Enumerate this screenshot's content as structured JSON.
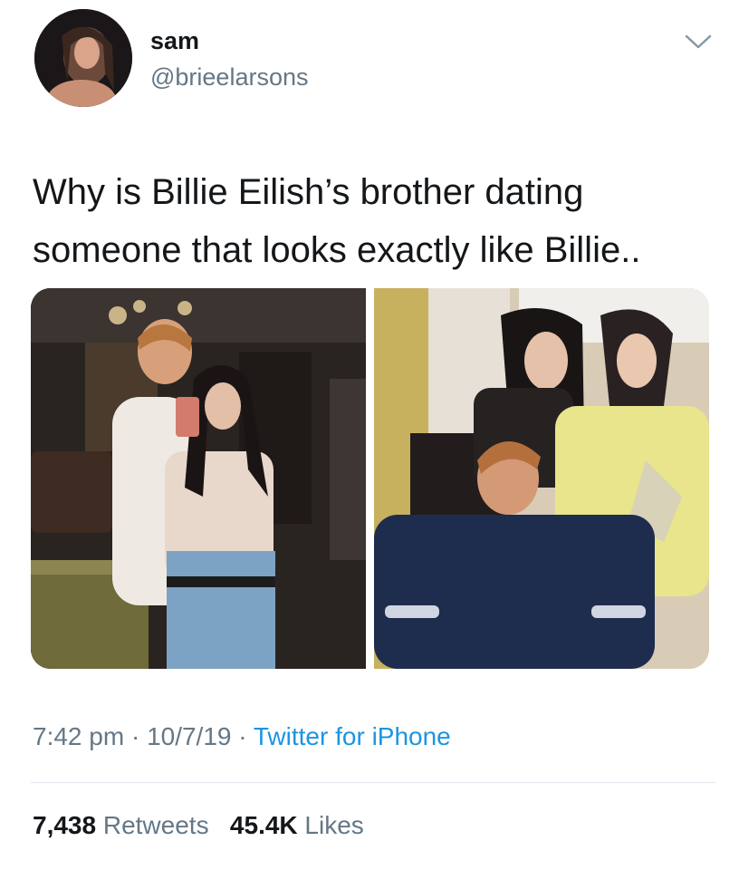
{
  "tweet": {
    "display_name": "sam",
    "handle": "@brieelarsons",
    "text": "Why is Billie Eilish’s brother dating\nsomeone that looks exactly like Billie..",
    "time": "7:42 pm",
    "separator": "·",
    "date": "10/7/19",
    "source": "Twitter for iPhone",
    "retweets_count": "7,438",
    "retweets_label": "Retweets",
    "likes_count": "45.4K",
    "likes_label": "Likes"
  },
  "icons": {
    "menu": "chevron-down-icon"
  },
  "colors": {
    "text": "#14171a",
    "secondary": "#657786",
    "link": "#1b95e0",
    "divider": "#e1e8ed"
  }
}
